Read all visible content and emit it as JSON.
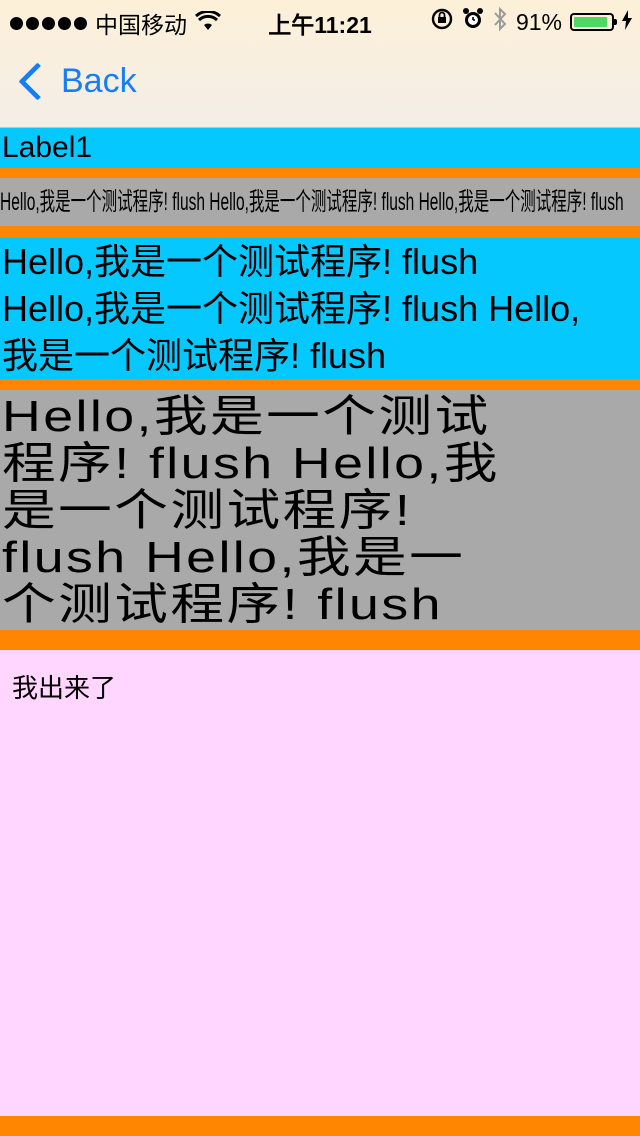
{
  "status_bar": {
    "carrier": "中国移动",
    "time": "上午11:21",
    "battery": "91%",
    "battery_level": 0.91,
    "icons": [
      "signal-dots-icon",
      "wifi-icon",
      "rotation-lock-icon",
      "alarm-icon",
      "bluetooth-icon",
      "battery-icon",
      "charging-icon"
    ]
  },
  "nav": {
    "back_label": "Back"
  },
  "labels": {
    "label1": "Label1",
    "label2": "Hello,我是一个测试程序! flush  Hello,我是一个测试程序! flush Hello,我是一个测试程序! flush",
    "label3_lines": [
      "Hello,我是一个测试程序! flush",
      "Hello,我是一个测试程序! flush Hello,",
      "我是一个测试程序! flush"
    ],
    "label4_lines": [
      "Hello,我是一个测试",
      "程序! flush  Hello,我",
      "是一个测试程序!",
      "flush Hello,我是一",
      "个测试程序! flush"
    ]
  },
  "content": {
    "message": "我出来了"
  },
  "colors": {
    "background_orange": "#ff8600",
    "label_cyan": "#05c8ff",
    "label_gray": "#a9a9a9",
    "panel_pink": "#ffd6ff",
    "ios_blue": "#157efb",
    "battery_green": "#4cd964"
  }
}
